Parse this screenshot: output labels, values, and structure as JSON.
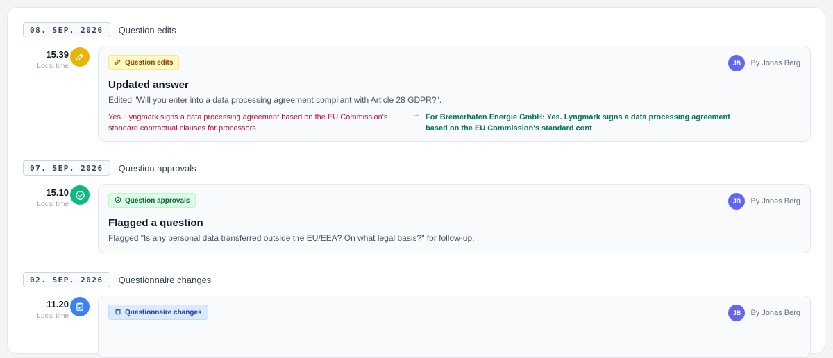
{
  "colors": {
    "edit_icon_bg": "#eab308",
    "approval_icon_bg": "#10b981",
    "questionnaire_icon_bg": "#3b82f6",
    "avatar_bg": "#6366f1"
  },
  "sections": [
    {
      "date": "08. SEP. 2026",
      "group": "Question edits",
      "time": "15.39",
      "time_sub": "Local time",
      "icon": "pencil-icon",
      "tag": "Question edits",
      "author_initials": "JB",
      "author": "By Jonas Berg",
      "title": "Updated answer",
      "description": "Edited \"Will you enter into a data processing agreement compliant with Article 28 GDPR?\".",
      "old_value": "Yes. Lyngmark signs a data processing agreement based on the EU Commission's standard contractual clauses for processors",
      "new_value": "For Bremerhafen Energie GmbH: Yes. Lyngmark signs a data processing agreement based on the EU Commission's standard cont"
    },
    {
      "date": "07. SEP. 2026",
      "group": "Question approvals",
      "time": "15.10",
      "time_sub": "Local time",
      "icon": "check-circle-icon",
      "tag": "Question approvals",
      "author_initials": "JB",
      "author": "By Jonas Berg",
      "title": "Flagged a question",
      "description": "Flagged \"Is any personal data transferred outside the EU/EEA? On what legal basis?\" for follow-up."
    },
    {
      "date": "02. SEP. 2026",
      "group": "Questionnaire changes",
      "time": "11.20",
      "time_sub": "Local time",
      "icon": "clipboard-icon",
      "tag": "Questionnaire changes",
      "author_initials": "JB",
      "author": "By Jonas Berg"
    }
  ]
}
